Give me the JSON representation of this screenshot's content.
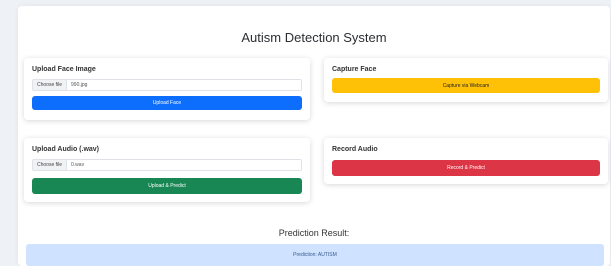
{
  "page": {
    "title": "Autism Detection System"
  },
  "upload_face": {
    "title": "Upload Face Image",
    "choose_file": "Choose file",
    "file_name": "990.jpg",
    "button": "Upload Face"
  },
  "capture_face": {
    "title": "Capture Face",
    "button": "Capture via Webcam"
  },
  "upload_audio": {
    "title": "Upload Audio (.wav)",
    "choose_file": "Choose file",
    "file_name": "0.wav",
    "button": "Upload & Predict"
  },
  "record_audio": {
    "title": "Record Audio",
    "button": "Record & Predict"
  },
  "prediction": {
    "title": "Prediction Result:",
    "value": "Prediction: AUTISM"
  },
  "colors": {
    "primary": "#0d6efd",
    "warning": "#ffc107",
    "success": "#198754",
    "danger": "#dc3545",
    "info_bg": "#cfe2ff"
  }
}
